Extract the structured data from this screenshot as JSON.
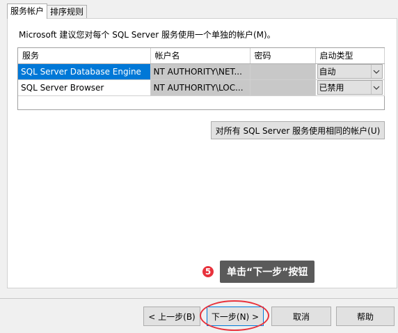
{
  "tabs": [
    {
      "label": "服务帐户",
      "active": true
    },
    {
      "label": "排序规则",
      "active": false
    }
  ],
  "instruction": "Microsoft 建议您对每个 SQL Server 服务使用一个单独的帐户(M)。",
  "grid": {
    "columns": [
      "服务",
      "帐户名",
      "密码",
      "启动类型"
    ],
    "rows": [
      {
        "service": "SQL Server Database Engine",
        "account": "NT AUTHORITY\\NET...",
        "password": "",
        "startup": "自动",
        "selected": true
      },
      {
        "service": "SQL Server Browser",
        "account": "NT AUTHORITY\\LOC...",
        "password": "",
        "startup": "已禁用",
        "selected": false
      }
    ]
  },
  "same_account_button": "对所有 SQL Server 服务使用相同的帐户(U)",
  "callout": {
    "number": "5",
    "text": "单击“下一步”按钮"
  },
  "buttons": {
    "back": "< 上一步(B)",
    "next": "下一步(N) >",
    "cancel": "取消",
    "help": "帮助"
  },
  "colors": {
    "selection": "#0078d7",
    "callout_badge": "#e8323c",
    "callout_bg": "#5a5a5a"
  }
}
